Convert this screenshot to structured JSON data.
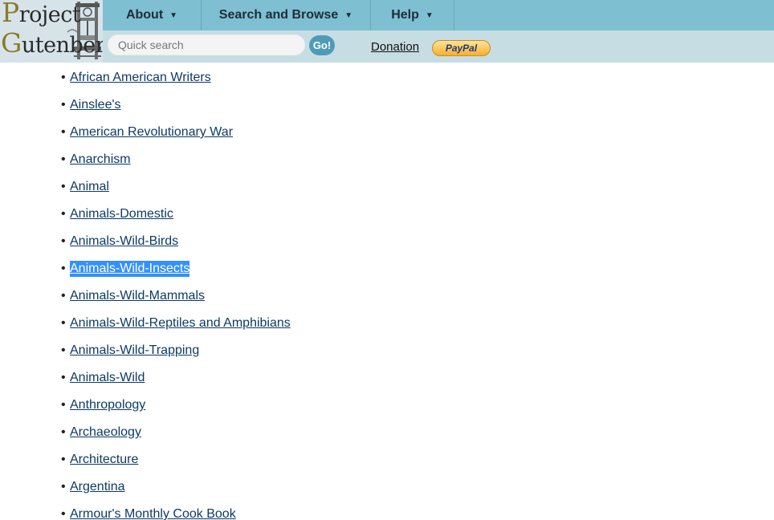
{
  "logo": {
    "line1_cap": "P",
    "line1_rest": "roject",
    "line2_cap": "G",
    "line2_rest": "utenberg"
  },
  "nav": {
    "about": "About",
    "search_browse": "Search and Browse",
    "help": "Help"
  },
  "search": {
    "placeholder": "Quick search",
    "go_label": "Go!"
  },
  "donation_label": "Donation",
  "paypal_label": "PayPal",
  "subjects": [
    "African American Writers",
    "Ainslee's",
    "American Revolutionary War",
    "Anarchism",
    "Animal",
    "Animals-Domestic",
    "Animals-Wild-Birds",
    "Animals-Wild-Insects",
    "Animals-Wild-Mammals",
    "Animals-Wild-Reptiles and Amphibians",
    "Animals-Wild-Trapping",
    "Animals-Wild",
    "Anthropology",
    "Archaeology",
    "Architecture",
    "Argentina",
    "Armour's Monthly Cook Book"
  ],
  "selected_subject": "Animals-Wild-Insects",
  "colors": {
    "nav_bar": "#7fbfd2",
    "sub_bar": "#c7dde4",
    "link": "#0d3a66",
    "selection": "#3390ff"
  }
}
